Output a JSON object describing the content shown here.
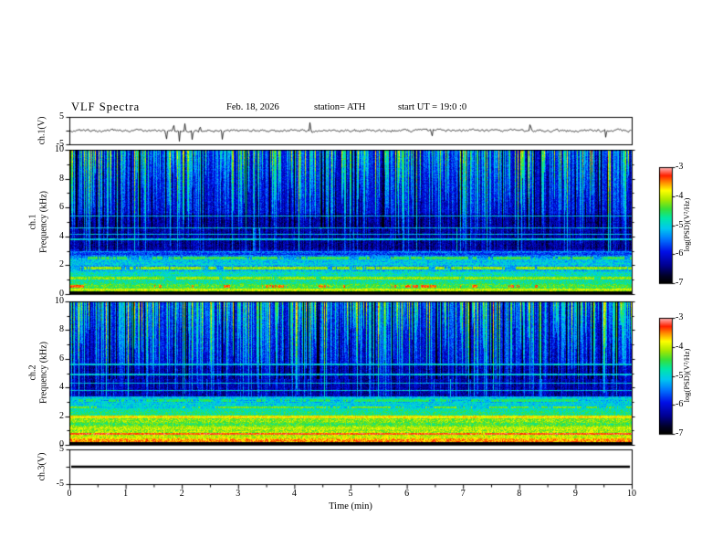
{
  "header": {
    "title": "VLF  Spectra",
    "date": "Feb. 18, 2026",
    "station": "station= ATH",
    "start_ut": "start UT  =   19:0  :0"
  },
  "x_axis": {
    "label": "Time  (min)",
    "ticks": [
      "0",
      "1",
      "2",
      "3",
      "4",
      "5",
      "6",
      "7",
      "8",
      "9",
      "10"
    ]
  },
  "panels": {
    "wave1": {
      "ylabel": "ch.1(V)",
      "ticks": [
        "5",
        "-5"
      ]
    },
    "spec1": {
      "ylabel_line1": "ch.1",
      "ylabel_line2": "Frequency  (kHz)",
      "ticks": [
        "10",
        "8",
        "6",
        "4",
        "2",
        "0"
      ]
    },
    "spec2": {
      "ylabel_line1": "ch.2",
      "ylabel_line2": "Frequency  (kHz)",
      "ticks": [
        "10",
        "8",
        "6",
        "4",
        "2",
        "0"
      ]
    },
    "wave3": {
      "ylabel": "ch.3(V)",
      "ticks": [
        "5",
        "-5"
      ]
    }
  },
  "colorbar": {
    "label": "log(PSD)(V²/Hz)",
    "ticks": [
      "-3",
      "-4",
      "-5",
      "-6",
      "-7"
    ],
    "stops": [
      {
        "t": 0.0,
        "color": "#000000"
      },
      {
        "t": 0.06,
        "color": "#000028"
      },
      {
        "t": 0.15,
        "color": "#000090"
      },
      {
        "t": 0.27,
        "color": "#0010e8"
      },
      {
        "t": 0.38,
        "color": "#0078ff"
      },
      {
        "t": 0.47,
        "color": "#00c8f0"
      },
      {
        "t": 0.56,
        "color": "#00e8a8"
      },
      {
        "t": 0.64,
        "color": "#38e038"
      },
      {
        "t": 0.72,
        "color": "#a8e800"
      },
      {
        "t": 0.8,
        "color": "#ffff00"
      },
      {
        "t": 0.87,
        "color": "#ff8c00"
      },
      {
        "t": 0.93,
        "color": "#ff2000"
      },
      {
        "t": 1.0,
        "color": "#ffb4b4"
      }
    ]
  },
  "chart_data": {
    "type": "heatmap",
    "title": "VLF Spectra",
    "date": "Feb. 18, 2026",
    "station": "ATH",
    "start_ut": "19:0:0",
    "xlabel": "Time (min)",
    "x_range": [
      0,
      10
    ],
    "x_ticks": [
      0,
      1,
      2,
      3,
      4,
      5,
      6,
      7,
      8,
      9,
      10
    ],
    "z_label": "log(PSD)(V^2/Hz)",
    "z_range": [
      -7,
      -3
    ],
    "z_ticks": [
      -3,
      -4,
      -5,
      -6,
      -7
    ],
    "panels": [
      {
        "id": "ch1-waveform",
        "type": "line",
        "ylabel": "ch.1(V)",
        "y_range": [
          -5,
          5
        ],
        "summary": "broadband noise about 0 V, rms ~0.5 V, impulsive spikes to ~±4 V",
        "spike_times_min": [
          1.72,
          1.85,
          1.95,
          2.05,
          2.18,
          2.32,
          2.72,
          4.28,
          6.45,
          8.2,
          9.55
        ]
      },
      {
        "id": "ch1-spectrogram",
        "type": "heatmap",
        "ylabel": "ch.1 Frequency (kHz)",
        "y_range": [
          0,
          10
        ],
        "y_ticks": [
          0,
          2,
          4,
          6,
          8,
          10
        ],
        "background_psd": -6.15,
        "low_band": {
          "f_max_khz": 3.0,
          "base_psd": -5.7,
          "slope_per_khz": 0.5
        },
        "bright_rows": [
          {
            "f_khz": 0.32,
            "psd": -4.0,
            "coverage": 0.9
          },
          {
            "f_khz": 0.55,
            "psd": -3.4,
            "coverage": 0.35
          },
          {
            "f_khz": 1.1,
            "psd": -4.2,
            "coverage": 0.75
          },
          {
            "f_khz": 1.8,
            "psd": -4.2,
            "coverage": 0.7
          },
          {
            "f_khz": 2.5,
            "psd": -4.5,
            "coverage": 0.6
          }
        ],
        "carrier_lines_khz": [
          3.8,
          4.15,
          4.6,
          5.4
        ],
        "black_band_khz": [
          0,
          0.22
        ],
        "sferic_streaks": "dense vertical impulsive streaks 4-10 kHz on blue background"
      },
      {
        "id": "ch2-spectrogram",
        "type": "heatmap",
        "ylabel": "ch.2 Frequency (kHz)",
        "y_range": [
          0,
          10
        ],
        "y_ticks": [
          0,
          2,
          4,
          6,
          8,
          10
        ],
        "background_psd": -6.05,
        "low_band": {
          "f_max_khz": 3.4,
          "base_psd": -5.3,
          "slope_per_khz": 0.55
        },
        "bright_rows": [
          {
            "f_khz": 0.32,
            "psd": -3.9,
            "coverage": 0.9
          },
          {
            "f_khz": 0.75,
            "psd": -3.3,
            "coverage": 0.9
          },
          {
            "f_khz": 1.2,
            "psd": -4.1,
            "coverage": 0.6
          },
          {
            "f_khz": 1.95,
            "psd": -3.8,
            "coverage": 0.95
          },
          {
            "f_khz": 2.6,
            "psd": -4.3,
            "coverage": 0.5
          },
          {
            "f_khz": 3.1,
            "psd": -4.6,
            "coverage": 0.5
          }
        ],
        "carrier_lines_khz": [
          3.8,
          4.3,
          4.9,
          5.6
        ],
        "black_band_khz": [
          0,
          0.22
        ],
        "sferic_streaks": "dense vertical impulsive streaks 4-10 kHz, low band brighter (yellow/orange) than ch.1"
      },
      {
        "id": "ch3-waveform",
        "type": "line",
        "ylabel": "ch.3(V)",
        "y_range": [
          -5,
          5
        ],
        "summary": "flat thick line at 0 V (no signal)",
        "constant_value": 0
      }
    ]
  }
}
